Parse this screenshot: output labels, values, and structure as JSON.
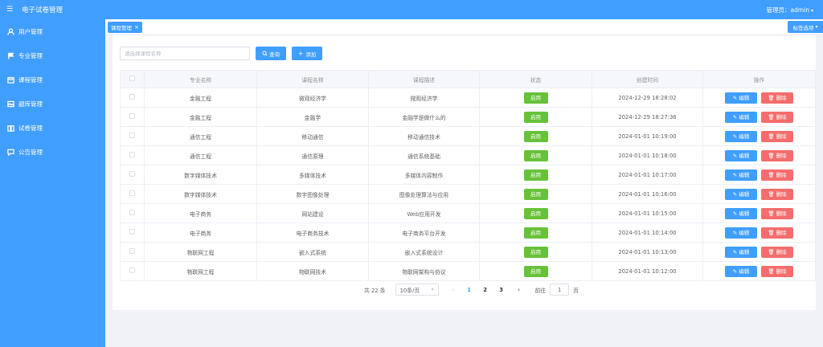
{
  "app": {
    "title": "电子试卷管理",
    "menu_icon": "menu-icon"
  },
  "header": {
    "user_label": "管理员：admin",
    "caret": "▾"
  },
  "sidebar": {
    "items": [
      {
        "label": "用户管理",
        "icon": "user-icon"
      },
      {
        "label": "专业管理",
        "icon": "flag-icon"
      },
      {
        "label": "课程管理",
        "icon": "calendar-icon"
      },
      {
        "label": "题库管理",
        "icon": "image-icon"
      },
      {
        "label": "试卷管理",
        "icon": "book-icon"
      },
      {
        "label": "公告管理",
        "icon": "chat-icon"
      }
    ]
  },
  "tags": {
    "active_tag": "课程管理",
    "close_glyph": "×",
    "options_label": "标签选项"
  },
  "toolbar": {
    "search_placeholder": "请选择课程名称",
    "query_label": "查询",
    "add_label": "添加"
  },
  "table": {
    "headers": [
      "专业名称",
      "课程名称",
      "课程描述",
      "状态",
      "创建时间",
      "操作"
    ],
    "status_label": "启用",
    "edit_label": "编辑",
    "delete_label": "删除",
    "rows": [
      {
        "major": "金融工程",
        "course": "微观经济学",
        "desc": "微观经济学",
        "created": "2024-12-29 18:28:02"
      },
      {
        "major": "金融工程",
        "course": "金融学",
        "desc": "金融学是做什么的",
        "created": "2024-12-29 18:27:36"
      },
      {
        "major": "通信工程",
        "course": "移动通信",
        "desc": "移动通信技术",
        "created": "2024-01-01 10:19:00"
      },
      {
        "major": "通信工程",
        "course": "通信原理",
        "desc": "通信系统基础",
        "created": "2024-01-01 10:18:00"
      },
      {
        "major": "数字媒体技术",
        "course": "多媒体技术",
        "desc": "多媒体内容制作",
        "created": "2024-01-01 10:17:00"
      },
      {
        "major": "数字媒体技术",
        "course": "数字图像处理",
        "desc": "图像处理算法与应用",
        "created": "2024-01-01 10:16:00"
      },
      {
        "major": "电子商务",
        "course": "网站建设",
        "desc": "Web应用开发",
        "created": "2024-01-01 10:15:00"
      },
      {
        "major": "电子商务",
        "course": "电子商务技术",
        "desc": "电子商务平台开发",
        "created": "2024-01-01 10:14:00"
      },
      {
        "major": "物联网工程",
        "course": "嵌入式系统",
        "desc": "嵌入式系统设计",
        "created": "2024-01-01 10:13:00"
      },
      {
        "major": "物联网工程",
        "course": "物联网技术",
        "desc": "物联网架构与协议",
        "created": "2024-01-01 10:12:00"
      }
    ]
  },
  "pagination": {
    "total_label": "共 22 条",
    "page_size": "10条/页",
    "prev": "‹",
    "next": "›",
    "pages": [
      "1",
      "2",
      "3"
    ],
    "current_page": "1",
    "goto_label": "前往",
    "goto_value": "1",
    "page_suffix": "页"
  },
  "colors": {
    "primary": "#409eff",
    "success": "#67c23a",
    "danger": "#f56c6c"
  }
}
